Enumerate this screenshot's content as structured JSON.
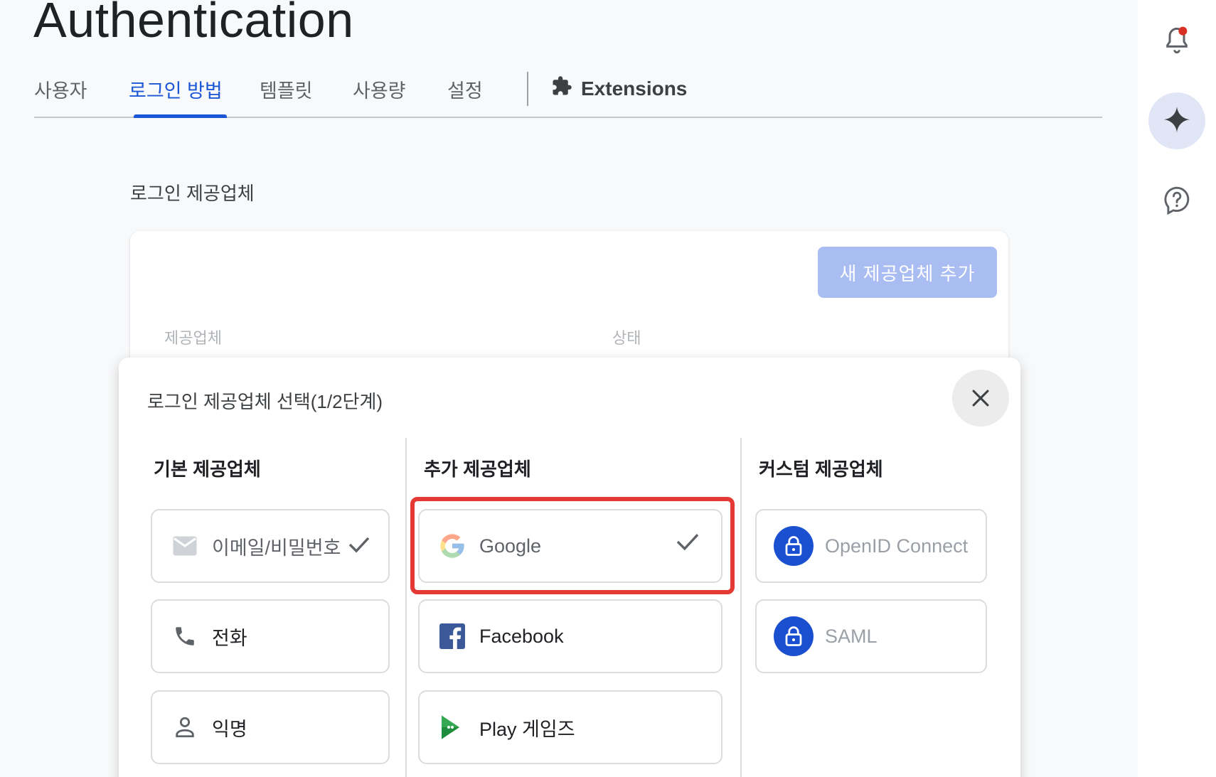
{
  "page": {
    "title": "Authentication"
  },
  "tabs": [
    {
      "label": "사용자"
    },
    {
      "label": "로그인 방법"
    },
    {
      "label": "템플릿"
    },
    {
      "label": "사용량"
    },
    {
      "label": "설정"
    },
    {
      "label": "Extensions"
    }
  ],
  "active_tab": "로그인 방법",
  "providers_section": {
    "title": "로그인 제공업체",
    "add_button": "새 제공업체 추가",
    "columns": [
      "제공업체",
      "상태"
    ]
  },
  "dialog": {
    "title": "로그인 제공업체 선택(1/2단계)",
    "columns": [
      {
        "heading": "기본 제공업체",
        "options": [
          {
            "label": "이메일/비밀번호",
            "icon": "mail-icon",
            "checked": true,
            "enabled": false
          },
          {
            "label": "전화",
            "icon": "phone-icon",
            "checked": false,
            "enabled": true
          },
          {
            "label": "익명",
            "icon": "person-icon",
            "checked": false,
            "enabled": true
          }
        ]
      },
      {
        "heading": "추가 제공업체",
        "options": [
          {
            "label": "Google",
            "icon": "google-icon",
            "checked": true,
            "enabled": false,
            "highlighted": true
          },
          {
            "label": "Facebook",
            "icon": "facebook-icon",
            "checked": false,
            "enabled": true
          },
          {
            "label": "Play 게임즈",
            "icon": "play-games-icon",
            "checked": false,
            "enabled": true
          }
        ]
      },
      {
        "heading": "커스텀 제공업체",
        "options": [
          {
            "label": "OpenID Connect",
            "icon": "lock-icon",
            "checked": false,
            "enabled": false
          },
          {
            "label": "SAML",
            "icon": "lock-icon",
            "checked": false,
            "enabled": false
          }
        ]
      }
    ]
  },
  "colors": {
    "accent": "#1a56d6",
    "highlight": "#e53935",
    "add_button_bg": "#aabdf3",
    "notification_dot": "#d93025"
  },
  "rail_icons": [
    "notification-bell-icon",
    "gemini-sparkle-icon",
    "help-icon"
  ]
}
